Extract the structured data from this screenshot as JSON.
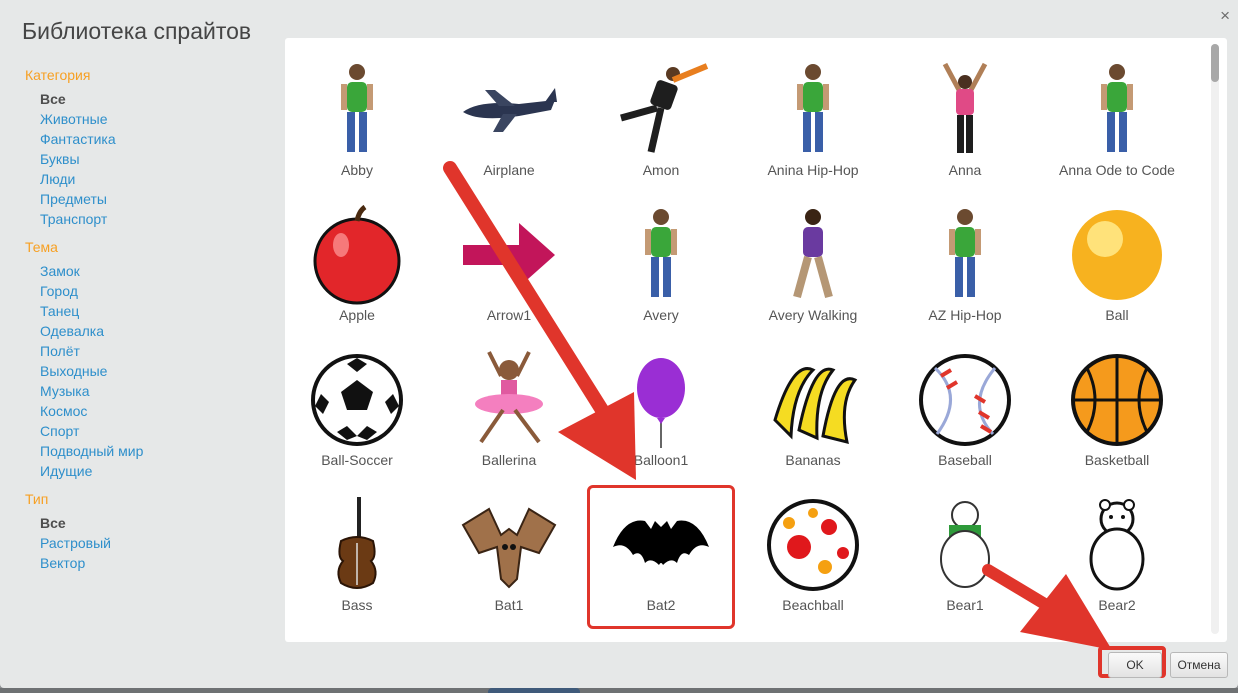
{
  "dialog": {
    "title": "Библиотека спрайтов",
    "close_label": "×"
  },
  "sidebar": {
    "groups": [
      {
        "heading": "Категория",
        "items": [
          {
            "label": "Все",
            "selected": true
          },
          {
            "label": "Животные"
          },
          {
            "label": "Фантастика"
          },
          {
            "label": "Буквы"
          },
          {
            "label": "Люди"
          },
          {
            "label": "Предметы"
          },
          {
            "label": "Транспорт"
          }
        ]
      },
      {
        "heading": "Тема",
        "items": [
          {
            "label": "Замок"
          },
          {
            "label": "Город"
          },
          {
            "label": "Танец"
          },
          {
            "label": "Одевалка"
          },
          {
            "label": "Полёт"
          },
          {
            "label": "Выходные"
          },
          {
            "label": "Музыка"
          },
          {
            "label": "Космос"
          },
          {
            "label": "Спорт"
          },
          {
            "label": "Подводный мир"
          },
          {
            "label": "Идущие"
          }
        ]
      },
      {
        "heading": "Тип",
        "items": [
          {
            "label": "Все",
            "selected": true
          },
          {
            "label": "Растровый"
          },
          {
            "label": "Вектор"
          }
        ]
      }
    ]
  },
  "sprites": [
    {
      "name": "Abby",
      "icon": "person-icon"
    },
    {
      "name": "Airplane",
      "icon": "airplane-icon"
    },
    {
      "name": "Amon",
      "icon": "dancer-icon"
    },
    {
      "name": "Anina Hip-Hop",
      "icon": "person-icon"
    },
    {
      "name": "Anna",
      "icon": "person-arms-up-icon"
    },
    {
      "name": "Anna Ode to Code",
      "icon": "person-icon"
    },
    {
      "name": "Apple",
      "icon": "apple-icon"
    },
    {
      "name": "Arrow1",
      "icon": "arrow-icon"
    },
    {
      "name": "Avery",
      "icon": "person-icon"
    },
    {
      "name": "Avery Walking",
      "icon": "person-walking-icon"
    },
    {
      "name": "AZ Hip-Hop",
      "icon": "person-icon"
    },
    {
      "name": "Ball",
      "icon": "ball-icon"
    },
    {
      "name": "Ball-Soccer",
      "icon": "soccer-ball-icon"
    },
    {
      "name": "Ballerina",
      "icon": "ballerina-icon"
    },
    {
      "name": "Balloon1",
      "icon": "balloon-icon"
    },
    {
      "name": "Bananas",
      "icon": "bananas-icon"
    },
    {
      "name": "Baseball",
      "icon": "baseball-icon"
    },
    {
      "name": "Basketball",
      "icon": "basketball-icon"
    },
    {
      "name": "Bass",
      "icon": "bass-icon"
    },
    {
      "name": "Bat1",
      "icon": "bat-icon"
    },
    {
      "name": "Bat2",
      "icon": "bat-silhouette-icon",
      "selected": true
    },
    {
      "name": "Beachball",
      "icon": "beachball-icon"
    },
    {
      "name": "Bear1",
      "icon": "bear-icon"
    },
    {
      "name": "Bear2",
      "icon": "bear-outline-icon"
    }
  ],
  "buttons": {
    "ok": "OK",
    "cancel": "Отмена"
  },
  "colors": {
    "annotation": "#e0352b",
    "link": "#2e8fcb",
    "heading": "#f7a023"
  }
}
